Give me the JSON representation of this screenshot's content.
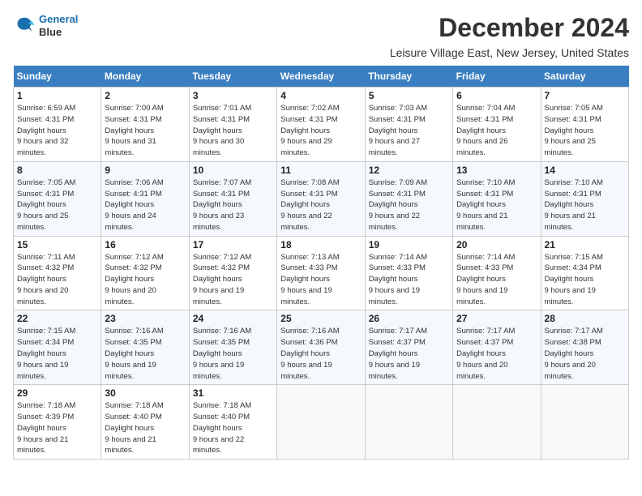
{
  "header": {
    "logo_line1": "General",
    "logo_line2": "Blue",
    "month_title": "December 2024",
    "location": "Leisure Village East, New Jersey, United States"
  },
  "days_of_week": [
    "Sunday",
    "Monday",
    "Tuesday",
    "Wednesday",
    "Thursday",
    "Friday",
    "Saturday"
  ],
  "weeks": [
    [
      {
        "day": "1",
        "sunrise": "6:59 AM",
        "sunset": "4:31 PM",
        "daylight": "9 hours and 32 minutes."
      },
      {
        "day": "2",
        "sunrise": "7:00 AM",
        "sunset": "4:31 PM",
        "daylight": "9 hours and 31 minutes."
      },
      {
        "day": "3",
        "sunrise": "7:01 AM",
        "sunset": "4:31 PM",
        "daylight": "9 hours and 30 minutes."
      },
      {
        "day": "4",
        "sunrise": "7:02 AM",
        "sunset": "4:31 PM",
        "daylight": "9 hours and 29 minutes."
      },
      {
        "day": "5",
        "sunrise": "7:03 AM",
        "sunset": "4:31 PM",
        "daylight": "9 hours and 27 minutes."
      },
      {
        "day": "6",
        "sunrise": "7:04 AM",
        "sunset": "4:31 PM",
        "daylight": "9 hours and 26 minutes."
      },
      {
        "day": "7",
        "sunrise": "7:05 AM",
        "sunset": "4:31 PM",
        "daylight": "9 hours and 25 minutes."
      }
    ],
    [
      {
        "day": "8",
        "sunrise": "7:05 AM",
        "sunset": "4:31 PM",
        "daylight": "9 hours and 25 minutes."
      },
      {
        "day": "9",
        "sunrise": "7:06 AM",
        "sunset": "4:31 PM",
        "daylight": "9 hours and 24 minutes."
      },
      {
        "day": "10",
        "sunrise": "7:07 AM",
        "sunset": "4:31 PM",
        "daylight": "9 hours and 23 minutes."
      },
      {
        "day": "11",
        "sunrise": "7:08 AM",
        "sunset": "4:31 PM",
        "daylight": "9 hours and 22 minutes."
      },
      {
        "day": "12",
        "sunrise": "7:09 AM",
        "sunset": "4:31 PM",
        "daylight": "9 hours and 22 minutes."
      },
      {
        "day": "13",
        "sunrise": "7:10 AM",
        "sunset": "4:31 PM",
        "daylight": "9 hours and 21 minutes."
      },
      {
        "day": "14",
        "sunrise": "7:10 AM",
        "sunset": "4:31 PM",
        "daylight": "9 hours and 21 minutes."
      }
    ],
    [
      {
        "day": "15",
        "sunrise": "7:11 AM",
        "sunset": "4:32 PM",
        "daylight": "9 hours and 20 minutes."
      },
      {
        "day": "16",
        "sunrise": "7:12 AM",
        "sunset": "4:32 PM",
        "daylight": "9 hours and 20 minutes."
      },
      {
        "day": "17",
        "sunrise": "7:12 AM",
        "sunset": "4:32 PM",
        "daylight": "9 hours and 19 minutes."
      },
      {
        "day": "18",
        "sunrise": "7:13 AM",
        "sunset": "4:33 PM",
        "daylight": "9 hours and 19 minutes."
      },
      {
        "day": "19",
        "sunrise": "7:14 AM",
        "sunset": "4:33 PM",
        "daylight": "9 hours and 19 minutes."
      },
      {
        "day": "20",
        "sunrise": "7:14 AM",
        "sunset": "4:33 PM",
        "daylight": "9 hours and 19 minutes."
      },
      {
        "day": "21",
        "sunrise": "7:15 AM",
        "sunset": "4:34 PM",
        "daylight": "9 hours and 19 minutes."
      }
    ],
    [
      {
        "day": "22",
        "sunrise": "7:15 AM",
        "sunset": "4:34 PM",
        "daylight": "9 hours and 19 minutes."
      },
      {
        "day": "23",
        "sunrise": "7:16 AM",
        "sunset": "4:35 PM",
        "daylight": "9 hours and 19 minutes."
      },
      {
        "day": "24",
        "sunrise": "7:16 AM",
        "sunset": "4:35 PM",
        "daylight": "9 hours and 19 minutes."
      },
      {
        "day": "25",
        "sunrise": "7:16 AM",
        "sunset": "4:36 PM",
        "daylight": "9 hours and 19 minutes."
      },
      {
        "day": "26",
        "sunrise": "7:17 AM",
        "sunset": "4:37 PM",
        "daylight": "9 hours and 19 minutes."
      },
      {
        "day": "27",
        "sunrise": "7:17 AM",
        "sunset": "4:37 PM",
        "daylight": "9 hours and 20 minutes."
      },
      {
        "day": "28",
        "sunrise": "7:17 AM",
        "sunset": "4:38 PM",
        "daylight": "9 hours and 20 minutes."
      }
    ],
    [
      {
        "day": "29",
        "sunrise": "7:18 AM",
        "sunset": "4:39 PM",
        "daylight": "9 hours and 21 minutes."
      },
      {
        "day": "30",
        "sunrise": "7:18 AM",
        "sunset": "4:40 PM",
        "daylight": "9 hours and 21 minutes."
      },
      {
        "day": "31",
        "sunrise": "7:18 AM",
        "sunset": "4:40 PM",
        "daylight": "9 hours and 22 minutes."
      },
      null,
      null,
      null,
      null
    ]
  ],
  "labels": {
    "sunrise": "Sunrise:",
    "sunset": "Sunset:",
    "daylight": "Daylight hours"
  }
}
